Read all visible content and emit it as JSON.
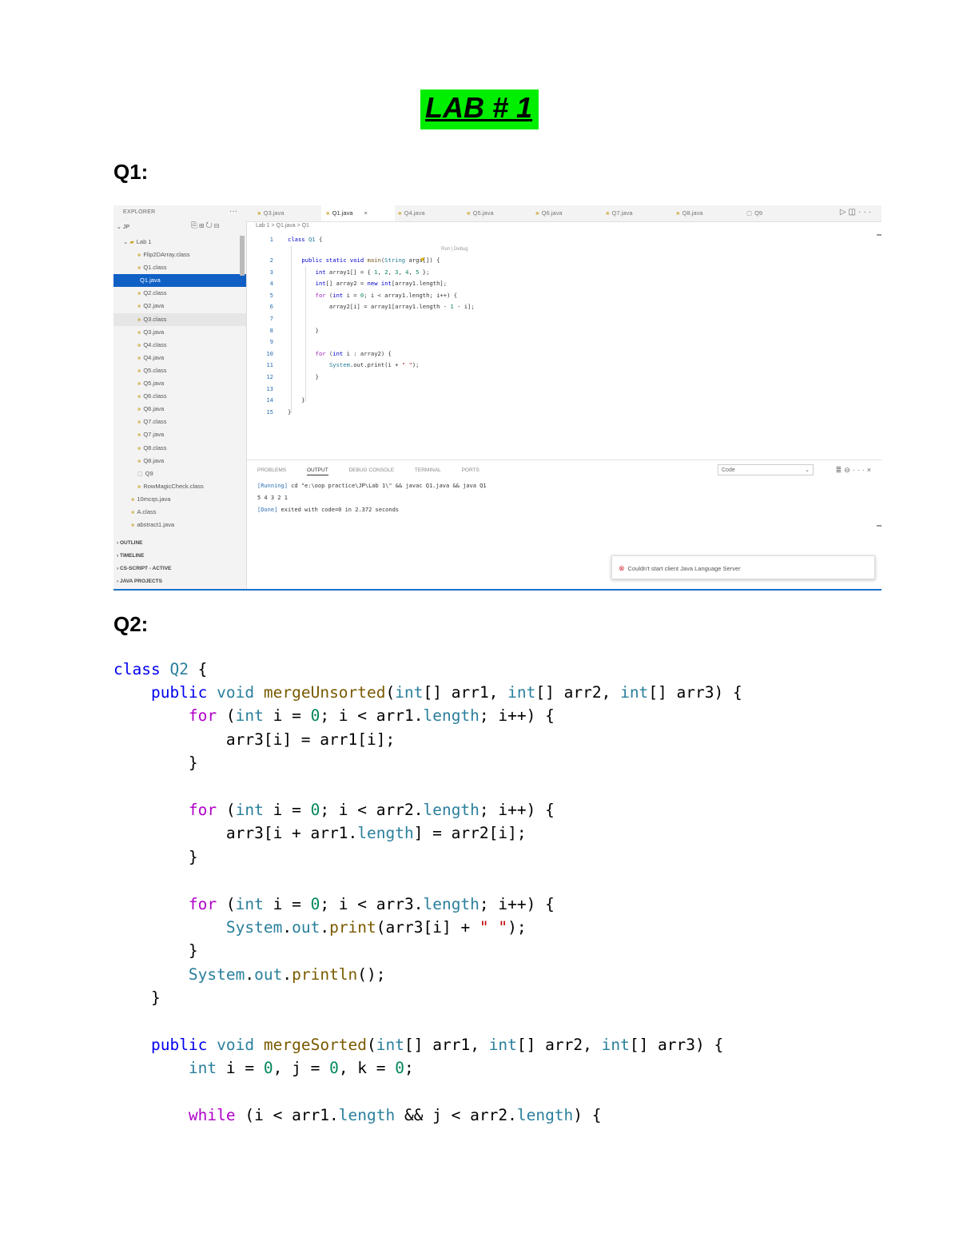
{
  "document": {
    "title": "LAB # 1",
    "q1_heading": "Q1:",
    "q2_heading": "Q2:"
  },
  "ide": {
    "explorer_label": "EXPLORER",
    "root_folder": "JP",
    "project_folder": "Lab 1",
    "files": [
      "Flip2DArray.class",
      "Q1.class",
      "Q1.java",
      "Q2.class",
      "Q2.java",
      "Q3.class",
      "Q3.java",
      "Q4.class",
      "Q4.java",
      "Q5.class",
      "Q5.java",
      "Q6.class",
      "Q6.java",
      "Q7.class",
      "Q7.java",
      "Q8.class",
      "Q8.java",
      "Q9",
      "RowMagicCheck.class",
      "10mcqs.java",
      "A.class",
      "abstract1.java"
    ],
    "sections": [
      "OUTLINE",
      "TIMELINE",
      "CS-SCRIPT - ACTIVE",
      "JAVA PROJECTS"
    ],
    "tabs": [
      "Q3.java",
      "Q1.java",
      "Q4.java",
      "Q5.java",
      "Q6.java",
      "Q7.java",
      "Q8.java",
      "Q9"
    ],
    "active_tab": "Q1.java",
    "breadcrumb": "Lab 1 > Q1.java > Q1",
    "codelens": "Run | Debug",
    "line_numbers": [
      "1",
      "2",
      "3",
      "4",
      "5",
      "6",
      "7",
      "8",
      "9",
      "10",
      "11",
      "12",
      "13",
      "14",
      "15"
    ],
    "panel_tabs": [
      "PROBLEMS",
      "OUTPUT",
      "DEBUG CONSOLE",
      "TERMINAL",
      "PORTS"
    ],
    "output_channel": "Code",
    "output_lines": {
      "running_tag": "[Running]",
      "running_cmd": " cd \"e:\\oop practice\\JP\\Lab 1\\\" && javac Q1.java && java Q1",
      "result": "5 4 3 2 1",
      "done_tag": "[Done]",
      "done_msg": " exited with code=0 in 2.372 seconds"
    },
    "notification": "Couldn't start client Java Language Server"
  }
}
